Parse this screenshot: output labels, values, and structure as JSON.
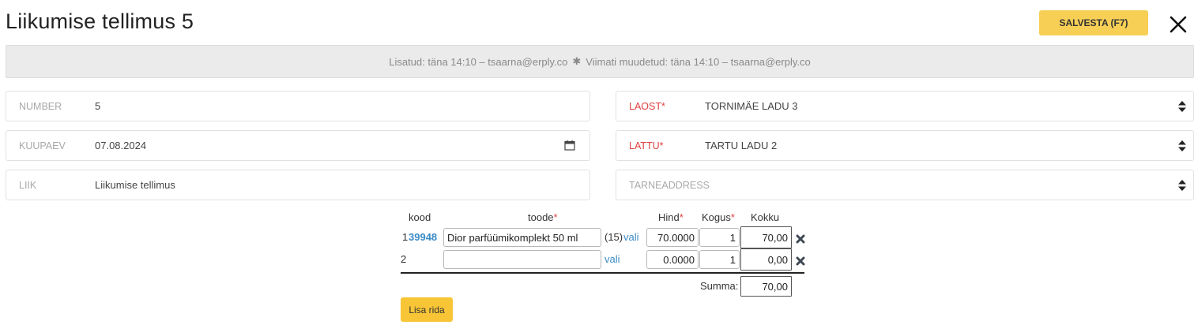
{
  "header": {
    "title": "Liikumise tellimus 5",
    "save_label": "SALVESTA (F7)"
  },
  "info": {
    "added": "Lisatud:  täna 14:10 – tsaarna@erply.co",
    "separator": "✱",
    "modified": "Viimati muudetud: täna 14:10 – tsaarna@erply.co"
  },
  "form": {
    "number": {
      "label": "NUMBER",
      "value": "5"
    },
    "date": {
      "label": "KUUPAEV",
      "value": "07.08.2024"
    },
    "type": {
      "label": "LIIK",
      "value": "Liikumise tellimus"
    },
    "from_warehouse": {
      "label": "LAOST",
      "required": "*",
      "value": "TORNIMÄE LADU 3"
    },
    "to_warehouse": {
      "label": "LATTU",
      "required": "*",
      "value": "TARTU LADU 2"
    },
    "delivery_address": {
      "placeholder": "TARNEADDRESS",
      "value": ""
    }
  },
  "table": {
    "headers": {
      "code": "kood",
      "product": "toode",
      "price": "Hind",
      "qty": "Kogus",
      "total": "Kokku",
      "required": "*"
    },
    "rows": [
      {
        "num": "1",
        "code": "39948",
        "product": "Dior parfüümikomplekt 50 ml",
        "stock": "(15)",
        "pick": "vali",
        "price": "70.0000",
        "qty": "1",
        "total": "70,00"
      },
      {
        "num": "2",
        "code": "",
        "product": "",
        "stock": "",
        "pick": "vali",
        "price": "0.0000",
        "qty": "1",
        "total": "0,00"
      }
    ],
    "sum_label": "Summa:",
    "sum_value": "70,00",
    "add_row_label": "Lisa rida"
  },
  "colors": {
    "accent": "#f7cf55",
    "required": "#e0403f",
    "link": "#3a8bc6"
  }
}
